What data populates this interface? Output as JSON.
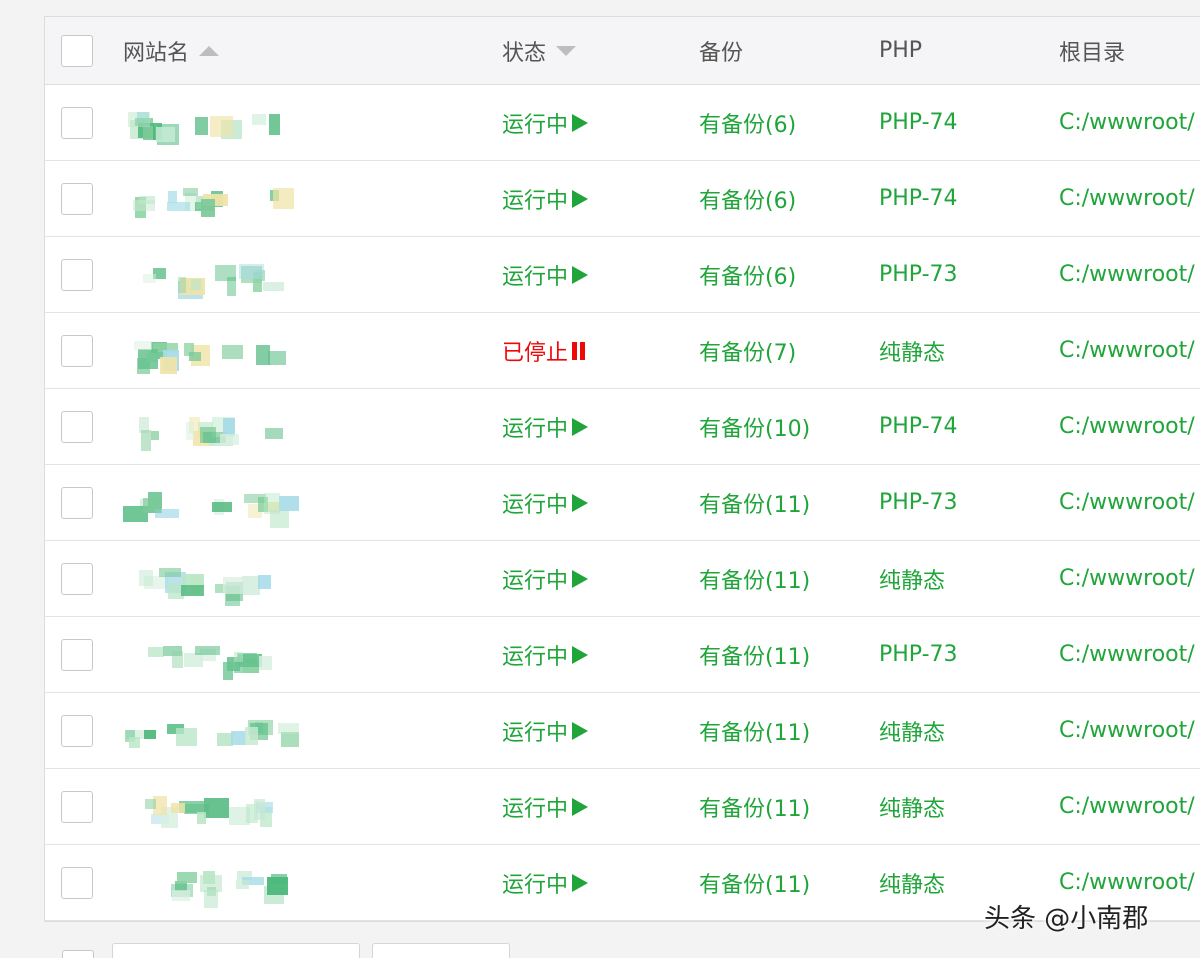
{
  "table": {
    "headers": {
      "name": "网站名",
      "status": "状态",
      "backup": "备份",
      "php": "PHP",
      "root": "根目录"
    },
    "rows": [
      {
        "status": "运行中",
        "state": "running",
        "backup": "有备份(6)",
        "php": "PHP-74",
        "root": "C:/wwwroot/"
      },
      {
        "status": "运行中",
        "state": "running",
        "backup": "有备份(6)",
        "php": "PHP-74",
        "root": "C:/wwwroot/"
      },
      {
        "status": "运行中",
        "state": "running",
        "backup": "有备份(6)",
        "php": "PHP-73",
        "root": "C:/wwwroot/"
      },
      {
        "status": "已停止",
        "state": "stopped",
        "backup": "有备份(7)",
        "php": "纯静态",
        "root": "C:/wwwroot/"
      },
      {
        "status": "运行中",
        "state": "running",
        "backup": "有备份(10)",
        "php": "PHP-74",
        "root": "C:/wwwroot/"
      },
      {
        "status": "运行中",
        "state": "running",
        "backup": "有备份(11)",
        "php": "PHP-73",
        "root": "C:/wwwroot/"
      },
      {
        "status": "运行中",
        "state": "running",
        "backup": "有备份(11)",
        "php": "纯静态",
        "root": "C:/wwwroot/"
      },
      {
        "status": "运行中",
        "state": "running",
        "backup": "有备份(11)",
        "php": "PHP-73",
        "root": "C:/wwwroot/"
      },
      {
        "status": "运行中",
        "state": "running",
        "backup": "有备份(11)",
        "php": "纯静态",
        "root": "C:/wwwroot/"
      },
      {
        "status": "运行中",
        "state": "running",
        "backup": "有备份(11)",
        "php": "纯静态",
        "root": "C:/wwwroot/"
      },
      {
        "status": "运行中",
        "state": "running",
        "backup": "有备份(11)",
        "php": "纯静态",
        "root": "C:/wwwroot/"
      }
    ]
  },
  "watermark": "头条 @小南郡",
  "colors": {
    "running": "#20a53a",
    "stopped": "#ef0808"
  },
  "icons": {
    "name_sort": "sort-up-icon",
    "status_sort": "sort-down-icon",
    "running": "play-icon",
    "stopped": "pause-icon"
  }
}
